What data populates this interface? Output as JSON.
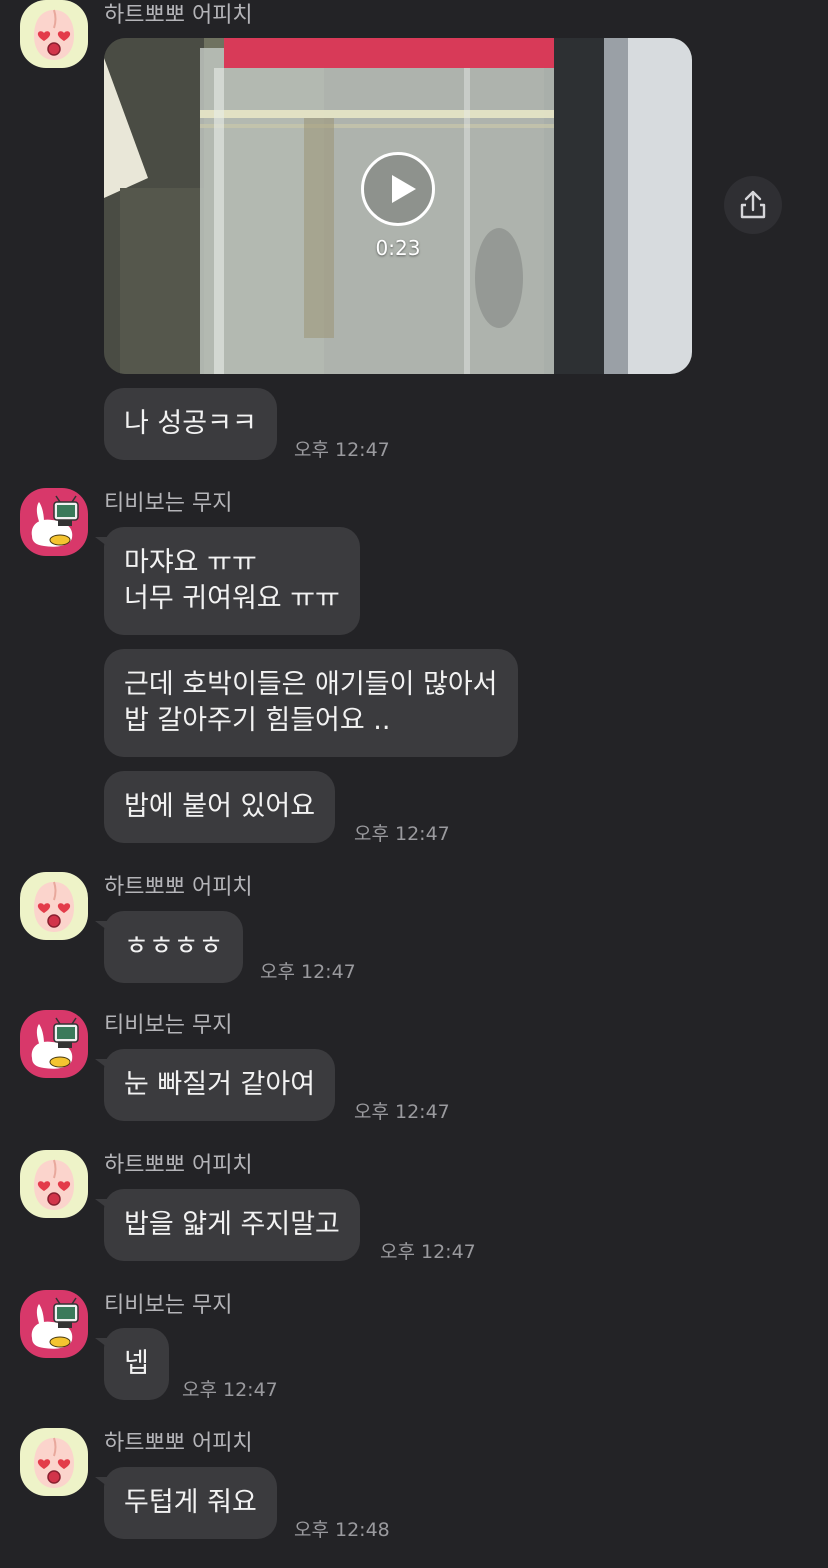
{
  "users": {
    "apeach": "하트뽀뽀 어피치",
    "muzi": "티비보는 무지"
  },
  "video": {
    "duration": "0:23"
  },
  "groups": {
    "g1": {
      "messages": [
        "나 성공ㅋㅋ"
      ],
      "time": "오후 12:47"
    },
    "g2": {
      "messages": [
        [
          "마쟈요 ㅠㅠ",
          "너무 귀여워요 ㅠㅠ"
        ],
        [
          "근데 호박이들은 애기들이 많아서",
          "밥 갈아주기 힘들어요 .."
        ],
        "밥에 붙어 있어요"
      ],
      "time": "오후 12:47"
    },
    "g3": {
      "messages": [
        "ㅎㅎㅎㅎ"
      ],
      "time": "오후 12:47"
    },
    "g4": {
      "messages": [
        "눈 빠질거 같아여"
      ],
      "time": "오후 12:47"
    },
    "g5": {
      "messages": [
        "밥을 얇게 주지말고"
      ],
      "time": "오후 12:47"
    },
    "g6": {
      "messages": [
        "넵"
      ],
      "time": "오후 12:47"
    },
    "g7": {
      "messages": [
        "두텁게 줘요"
      ],
      "time": "오후 12:48"
    }
  },
  "colors": {
    "background": "#232326",
    "bubble": "#3b3b3e",
    "apeach_avatar_bg": "#eef3c8",
    "muzi_avatar_bg": "#d8386a"
  },
  "icons": {
    "apeach_avatar": "apeach-heart-eyes-icon",
    "muzi_avatar": "muzi-tv-icon",
    "play": "play-icon",
    "share": "share-icon"
  }
}
